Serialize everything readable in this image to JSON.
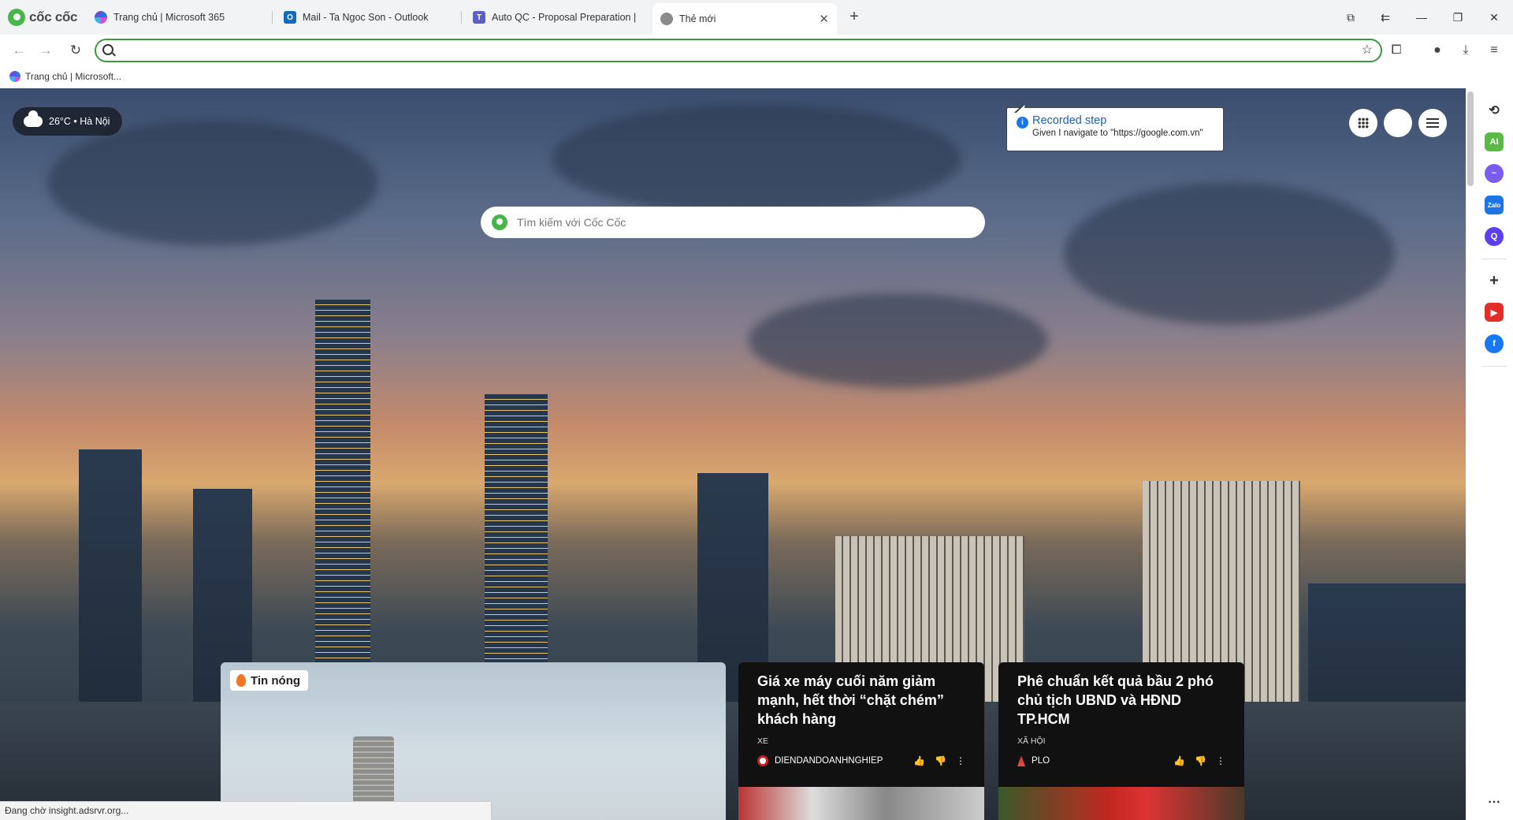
{
  "browser": {
    "brand": "cốc cốc",
    "tabs": [
      {
        "title": "Trang chủ | Microsoft 365"
      },
      {
        "title": "Mail - Ta Ngoc Son - Outlook"
      },
      {
        "title": "Auto QC - Proposal Preparation | Mic"
      },
      {
        "title": "Thẻ mới",
        "active": true
      }
    ],
    "address_bar": {
      "value": "",
      "placeholder": ""
    },
    "bookmarks": [
      {
        "label": "Trang chủ | Microsoft..."
      }
    ]
  },
  "page": {
    "weather": "26°C • Hà Nội",
    "search_placeholder": "Tìm kiếm với Cốc Cốc",
    "tooltip": {
      "title": "Recorded step",
      "text": "Given I navigate to \"https://google.com.vn\""
    },
    "hot_label": "Tin nóng",
    "news": [
      {
        "title": "Giá xe máy cuối năm giảm mạnh, hết thời “chặt chém” khách hàng",
        "category": "XE",
        "source": "DIENDANDOANHNGHIEP"
      },
      {
        "title": "Phê chuẩn kết quả bầu 2 phó chủ tịch UBND và HĐND TP.HCM",
        "category": "XÃ HỘI",
        "source": "PLO"
      }
    ]
  },
  "status_text": "Đang chờ insight.adsrvr.org...",
  "colors": {
    "accent": "#47b549",
    "focus_ring": "#3c9a3e"
  }
}
